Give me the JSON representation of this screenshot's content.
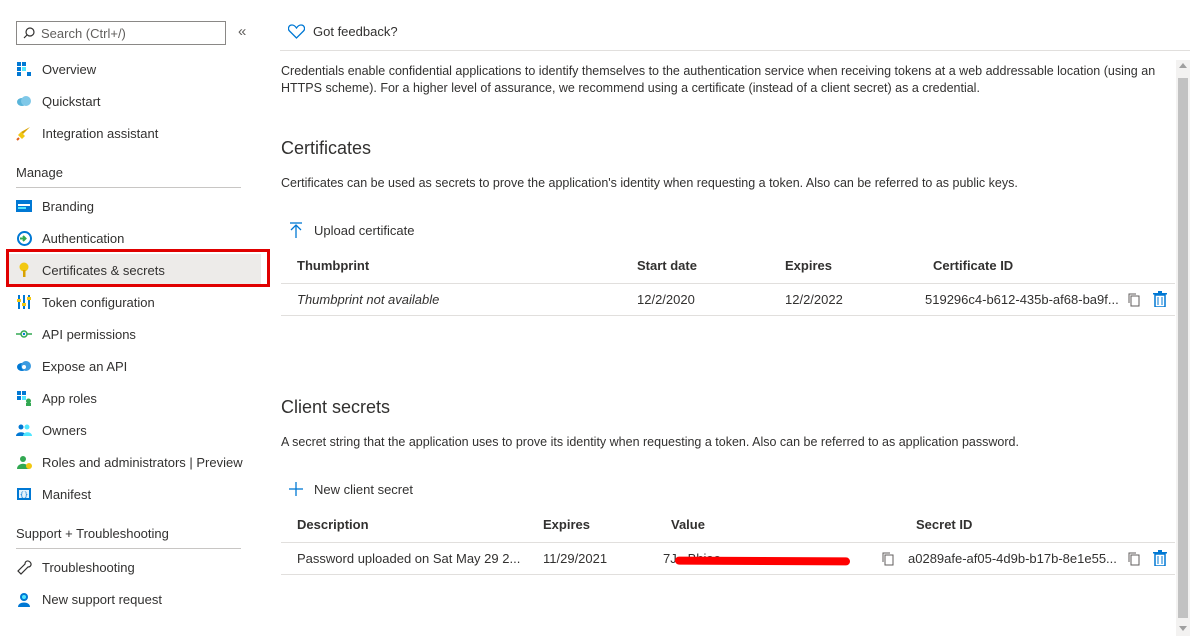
{
  "sidebar": {
    "search_placeholder": "Search (Ctrl+/)",
    "collapse_glyph": "«",
    "top_items": [
      {
        "label": "Overview",
        "icon": "grid-icon"
      },
      {
        "label": "Quickstart",
        "icon": "cloud-icon"
      },
      {
        "label": "Integration assistant",
        "icon": "rocket-icon"
      }
    ],
    "manage_heading": "Manage",
    "manage_items": [
      {
        "label": "Branding",
        "icon": "branding-icon"
      },
      {
        "label": "Authentication",
        "icon": "auth-icon"
      },
      {
        "label": "Certificates & secrets",
        "icon": "key-icon",
        "selected": true
      },
      {
        "label": "Token configuration",
        "icon": "bars-icon"
      },
      {
        "label": "API permissions",
        "icon": "api-icon"
      },
      {
        "label": "Expose an API",
        "icon": "cloud-api-icon"
      },
      {
        "label": "App roles",
        "icon": "app-roles-icon"
      },
      {
        "label": "Owners",
        "icon": "owners-icon"
      },
      {
        "label": "Roles and administrators | Preview",
        "icon": "roles-icon"
      },
      {
        "label": "Manifest",
        "icon": "manifest-icon"
      }
    ],
    "support_heading": "Support + Troubleshooting",
    "support_items": [
      {
        "label": "Troubleshooting",
        "icon": "wrench-icon"
      },
      {
        "label": "New support request",
        "icon": "support-icon"
      }
    ]
  },
  "header": {
    "feedback_label": "Got feedback?"
  },
  "main": {
    "intro": "Credentials enable confidential applications to identify themselves to the authentication service when receiving tokens at a web addressable location (using an HTTPS scheme). For a higher level of assurance, we recommend using a certificate (instead of a client secret) as a credential.",
    "certificates": {
      "title": "Certificates",
      "description": "Certificates can be used as secrets to prove the application's identity when requesting a token. Also can be referred to as public keys.",
      "upload_label": "Upload certificate",
      "columns": [
        "Thumbprint",
        "Start date",
        "Expires",
        "Certificate ID"
      ],
      "rows": [
        {
          "thumbprint": "Thumbprint not available",
          "start_date": "12/2/2020",
          "expires": "12/2/2022",
          "certificate_id": "519296c4-b612-435b-af68-ba9f..."
        }
      ]
    },
    "secrets": {
      "title": "Client secrets",
      "description": "A secret string that the application uses to prove its identity when requesting a token. Also can be referred to as application password.",
      "new_label": "New client secret",
      "columns": [
        "Description",
        "Expires",
        "Value",
        "Secret ID"
      ],
      "rows": [
        {
          "description": "Password uploaded on Sat May 29 2...",
          "expires": "11/29/2021",
          "value": "7J...Bhiae...",
          "secret_id": "a0289afe-af05-4d9b-b17b-8e1e55..."
        }
      ]
    }
  },
  "colors": {
    "accent": "#0078d4",
    "highlight_border": "#e00000",
    "selected_bg": "#edebe9"
  }
}
